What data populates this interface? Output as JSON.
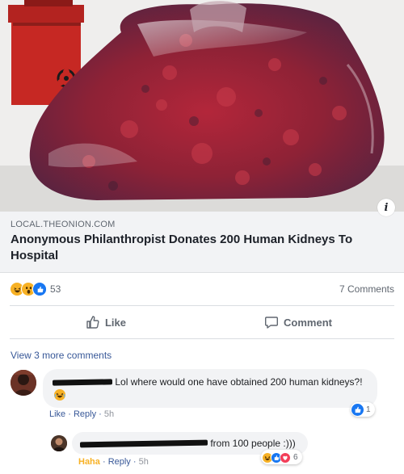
{
  "link_preview": {
    "image_icons": {
      "hazard": "biohazard-icon"
    },
    "domain": "LOCAL.THEONION.COM",
    "headline": "Anonymous Philanthropist Donates 200 Human Kidneys To Hospital",
    "info_icon": "i"
  },
  "stats": {
    "reactions": [
      "haha",
      "wow",
      "like"
    ],
    "reaction_count": "53",
    "comments_count": "7 Comments"
  },
  "actions": {
    "like": "Like",
    "comment": "Comment"
  },
  "comments": {
    "view_more": "View 3 more comments",
    "first": {
      "text_before_emoji": "Lol where would one have obtained 200 human kidneys?!",
      "like": "Like",
      "reply": "Reply",
      "time": "5h",
      "reaction_count": "1"
    },
    "reply": {
      "text": "from 100 people :)))",
      "haha": "Haha",
      "reply": "Reply",
      "time": "5h",
      "reaction_count": "6"
    }
  },
  "colors": {
    "link_blue": "#385898",
    "muted": "#606770",
    "like_blue": "#1877f2",
    "haha_yellow": "#f7b125",
    "love_red": "#f33e58"
  }
}
